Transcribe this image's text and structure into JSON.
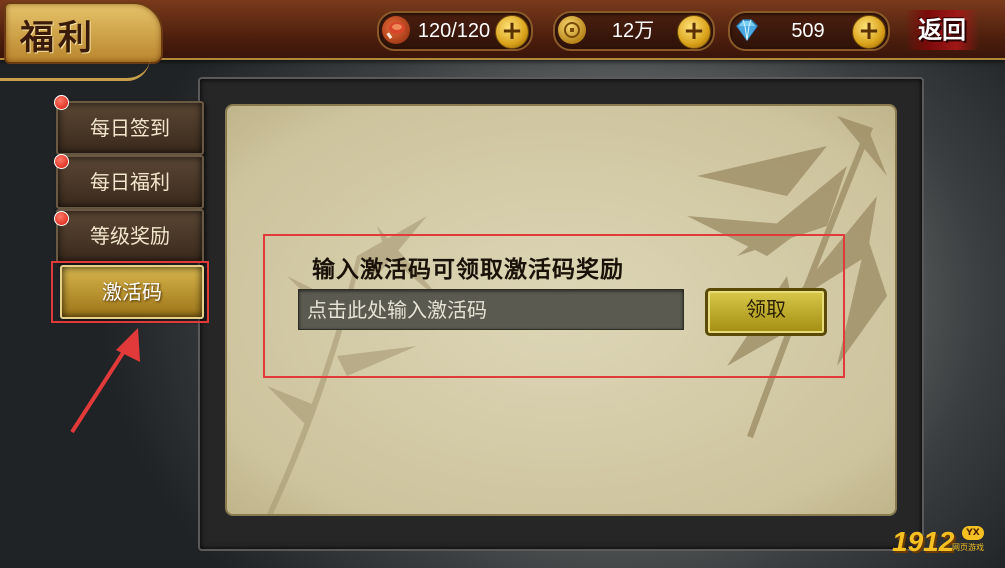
{
  "header": {
    "title": "福利",
    "resources": [
      {
        "icon": "meat-icon",
        "value": "120/120"
      },
      {
        "icon": "coin-icon",
        "value": "12万"
      },
      {
        "icon": "diamond-icon",
        "value": "509"
      }
    ],
    "back_label": "返回"
  },
  "sidebar": {
    "items": [
      {
        "label": "每日签到",
        "badge": true
      },
      {
        "label": "每日福利",
        "badge": true
      },
      {
        "label": "等级奖励",
        "badge": true
      },
      {
        "label": "激活码",
        "active": true
      }
    ]
  },
  "activation": {
    "prompt": "输入激活码可领取激活码奖励",
    "placeholder": "点击此处输入激活码",
    "claim_label": "领取"
  },
  "watermark": {
    "number": "1912",
    "badge": "YX",
    "subtitle": "网页游戏"
  },
  "colors": {
    "highlight": "#e23a3a",
    "gold": "#d7b54c",
    "bar": "#4a1d0c"
  }
}
